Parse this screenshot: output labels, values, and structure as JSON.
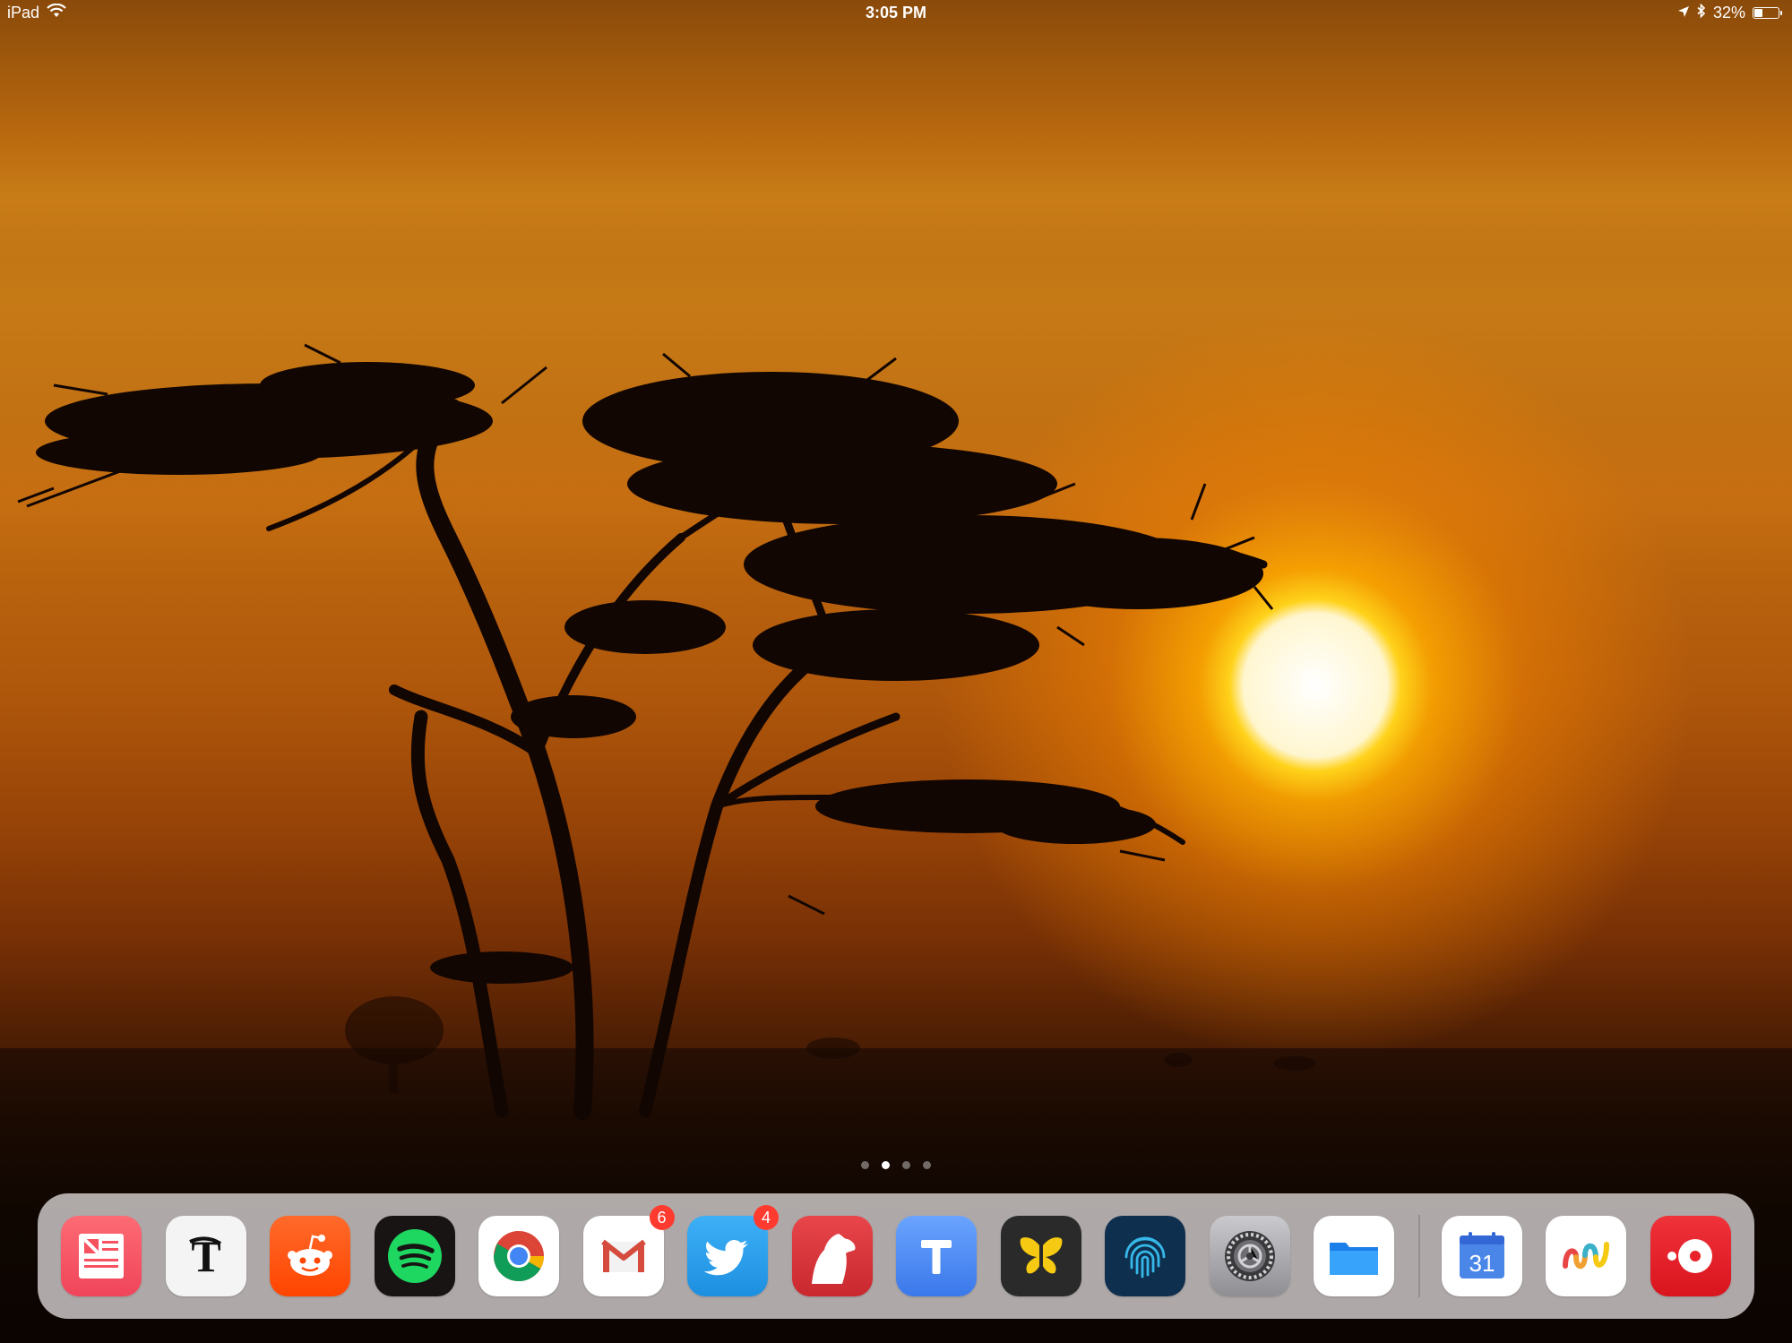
{
  "status_bar": {
    "device": "iPad",
    "time": "3:05 PM",
    "battery": "32%",
    "battery_level": 0.32,
    "icons": [
      "wifi-icon",
      "location-arrow-icon",
      "bluetooth-icon",
      "battery-icon"
    ]
  },
  "page_indicator": {
    "count": 4,
    "current": 2
  },
  "dock": {
    "apps": [
      {
        "icon": "news-app-icon",
        "color": "#f7525f"
      },
      {
        "icon": "nytimes-app-icon",
        "color": "#f4f4f4"
      },
      {
        "icon": "reddit-app-icon",
        "color": "#ff4500"
      },
      {
        "icon": "spotify-app-icon",
        "color": "#191414"
      },
      {
        "icon": "chrome-app-icon",
        "color": "#ffffff"
      },
      {
        "icon": "gmail-app-icon",
        "color": "#ffffff",
        "badge": "6"
      },
      {
        "icon": "twitter-app-icon",
        "color": "#1da1f2",
        "badge": "4"
      },
      {
        "icon": "bear-app-icon",
        "color": "#e0393e"
      },
      {
        "icon": "typeeto-app-icon",
        "color": "#4f8ef7"
      },
      {
        "icon": "ulysses-app-icon",
        "color": "#2a2a2a"
      },
      {
        "icon": "fingerprint-app-icon",
        "color": "#0f2f4f"
      },
      {
        "icon": "settings-app-icon",
        "color": "#8e8e93"
      },
      {
        "icon": "files-app-icon",
        "color": "#ffffff"
      },
      {
        "icon": "google-calendar-app-icon",
        "color": "#ffffff",
        "label": "31"
      },
      {
        "icon": "waveform-app-icon",
        "color": "#ffffff"
      },
      {
        "icon": "castro-app-icon",
        "color": "#e8212b"
      }
    ]
  }
}
